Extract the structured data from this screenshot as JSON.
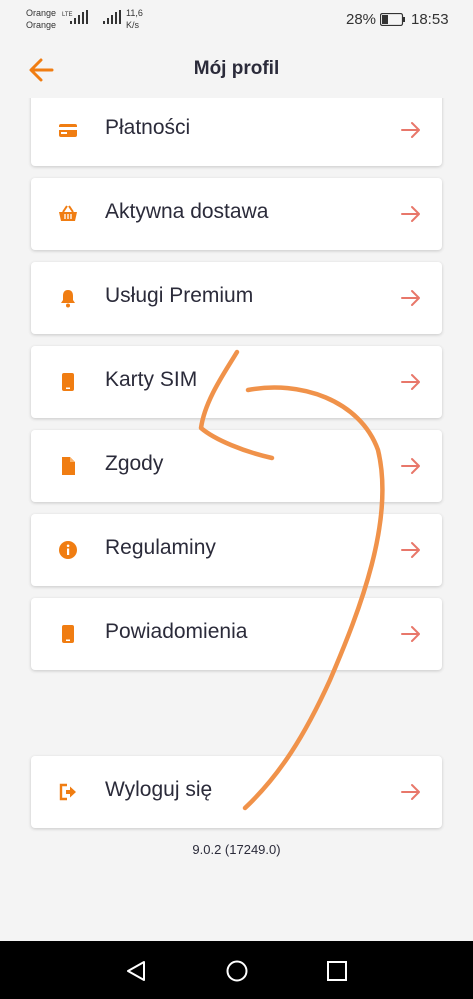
{
  "status": {
    "carrier_line1": "Orange",
    "carrier_line2": "Orange",
    "network": "LTE",
    "speed_value": "11,6",
    "speed_unit": "K/s",
    "battery": "28%",
    "time": "18:53"
  },
  "header": {
    "title": "Mój profil",
    "back_icon": "arrow-left-icon"
  },
  "menu": [
    {
      "label": "Płatności",
      "icon": "card-icon"
    },
    {
      "label": "Aktywna dostawa",
      "icon": "basket-icon"
    },
    {
      "label": "Usługi Premium",
      "icon": "bell-icon"
    },
    {
      "label": "Karty SIM",
      "icon": "phone-icon"
    },
    {
      "label": "Zgody",
      "icon": "document-icon"
    },
    {
      "label": "Regulaminy",
      "icon": "info-icon"
    },
    {
      "label": "Powiadomienia",
      "icon": "phone-icon"
    }
  ],
  "logout": {
    "label": "Wyloguj się",
    "icon": "sign-out-icon"
  },
  "version": "9.0.2 (17249.0)",
  "colors": {
    "accent": "#f07d12",
    "arrow": "#e8776a",
    "text": "#2b2b3a",
    "background": "#f4f4f4",
    "scribble": "#f0924a"
  },
  "nav": {
    "back": "triangle-back-icon",
    "home": "circle-home-icon",
    "recents": "square-recents-icon"
  }
}
